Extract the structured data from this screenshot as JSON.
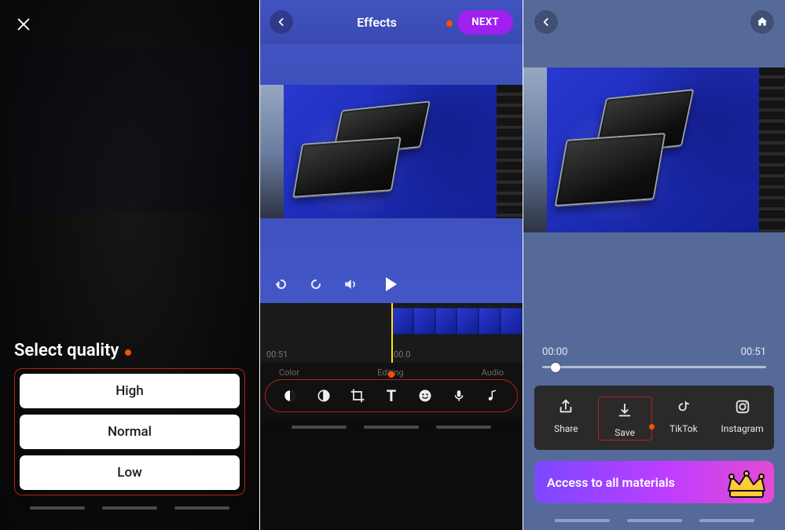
{
  "pane1": {
    "title": "Select quality",
    "options": {
      "high": "High",
      "normal": "Normal",
      "low": "Low"
    }
  },
  "pane2": {
    "title": "Effects",
    "nextLabel": "NEXT",
    "timeline": {
      "left": "00:51",
      "right": "00.0"
    },
    "groups": {
      "color": "Color",
      "editing": "Editing",
      "audio": "Audio"
    }
  },
  "pane3": {
    "progress": {
      "start": "00:00",
      "end": "00:51"
    },
    "actions": {
      "share": "Share",
      "save": "Save",
      "tiktok": "TikTok",
      "instagram": "Instagram"
    },
    "promo": "Access to all materials"
  }
}
